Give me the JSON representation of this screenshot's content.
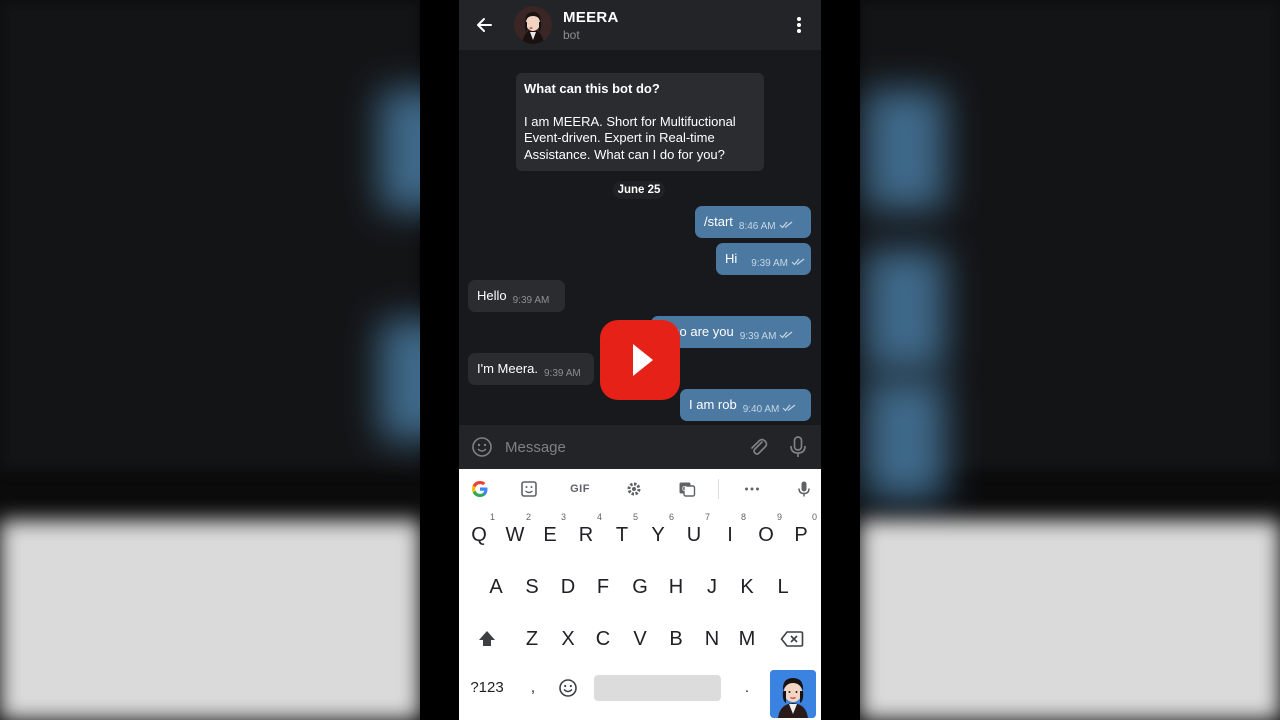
{
  "chat_header": {
    "title": "MEERA",
    "subtitle": "bot"
  },
  "bot_info": {
    "question": "What can this bot do?",
    "description": "I am MEERA. Short for Multifuctional Event-driven. Expert in Real-time Assistance. What can I do for you?"
  },
  "date_separator": "June 25",
  "messages": [
    {
      "direction": "out",
      "text": "/start",
      "time": "8:46 AM",
      "read": true
    },
    {
      "direction": "out",
      "text": "Hi",
      "time": "9:39 AM",
      "read": true
    },
    {
      "direction": "in",
      "text": "Hello",
      "time": "9:39 AM"
    },
    {
      "direction": "out",
      "text": "Who are you",
      "time": "9:39 AM",
      "read": true
    },
    {
      "direction": "in",
      "text": "I'm Meera.",
      "time": "9:39 AM"
    },
    {
      "direction": "out",
      "text": "I am rob",
      "time": "9:40 AM",
      "read": true
    }
  ],
  "composer": {
    "placeholder": "Message"
  },
  "keyboard": {
    "toolbar": [
      "google-icon",
      "sticker-icon",
      "GIF",
      "settings-icon",
      "translate-icon",
      "more-icon",
      "mic-icon"
    ],
    "gif_label": "GIF",
    "row1": [
      "Q",
      "W",
      "E",
      "R",
      "T",
      "Y",
      "U",
      "I",
      "O",
      "P"
    ],
    "row1_hints": [
      "1",
      "2",
      "3",
      "4",
      "5",
      "6",
      "7",
      "8",
      "9",
      "0"
    ],
    "row2": [
      "A",
      "S",
      "D",
      "F",
      "G",
      "H",
      "J",
      "K",
      "L"
    ],
    "row3": [
      "Z",
      "X",
      "C",
      "V",
      "B",
      "N",
      "M"
    ],
    "symbols_key": "?123",
    "comma_key": ",",
    "period_key": "."
  },
  "colors": {
    "outgoing_bubble": "#4b79a1",
    "incoming_bubble": "#2a2c30",
    "chat_background": "#18191c",
    "youtube_red": "#e62117"
  }
}
